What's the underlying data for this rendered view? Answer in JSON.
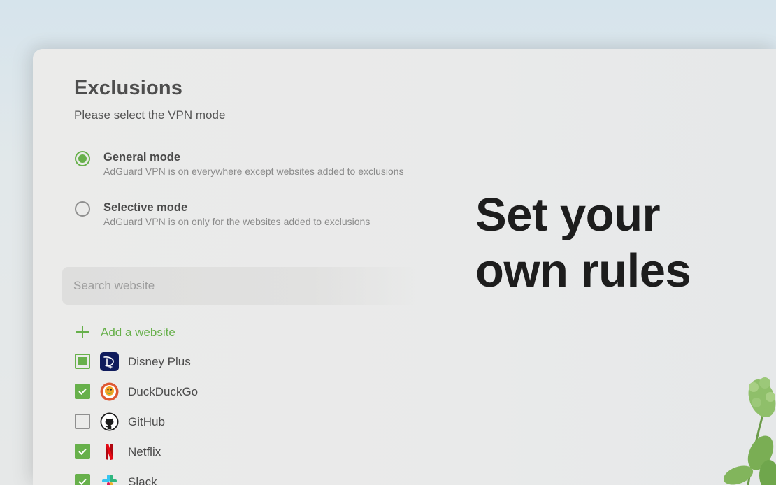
{
  "title": "Exclusions",
  "subtitle": "Please select the VPN mode",
  "modes": [
    {
      "name": "General mode",
      "description": "AdGuard VPN is on everywhere except websites added to exclusions",
      "selected": true
    },
    {
      "name": "Selective mode",
      "description": "AdGuard VPN is on only for the websites added to exclusions",
      "selected": false
    }
  ],
  "search": {
    "placeholder": "Search website"
  },
  "add_website_label": "Add a website",
  "sites": [
    {
      "name": "Disney Plus",
      "state": "partial",
      "icon": "disney-plus-icon"
    },
    {
      "name": "DuckDuckGo",
      "state": "checked",
      "icon": "duckduckgo-icon"
    },
    {
      "name": "GitHub",
      "state": "unchecked",
      "icon": "github-icon"
    },
    {
      "name": "Netflix",
      "state": "checked",
      "icon": "netflix-icon"
    },
    {
      "name": "Slack",
      "state": "checked",
      "icon": "slack-icon"
    }
  ],
  "headline": {
    "line1": "Set your",
    "line2": "own rules"
  },
  "colors": {
    "accent": "#67b04b",
    "headline": "#1d1d1d",
    "panel": "#ebebea"
  }
}
